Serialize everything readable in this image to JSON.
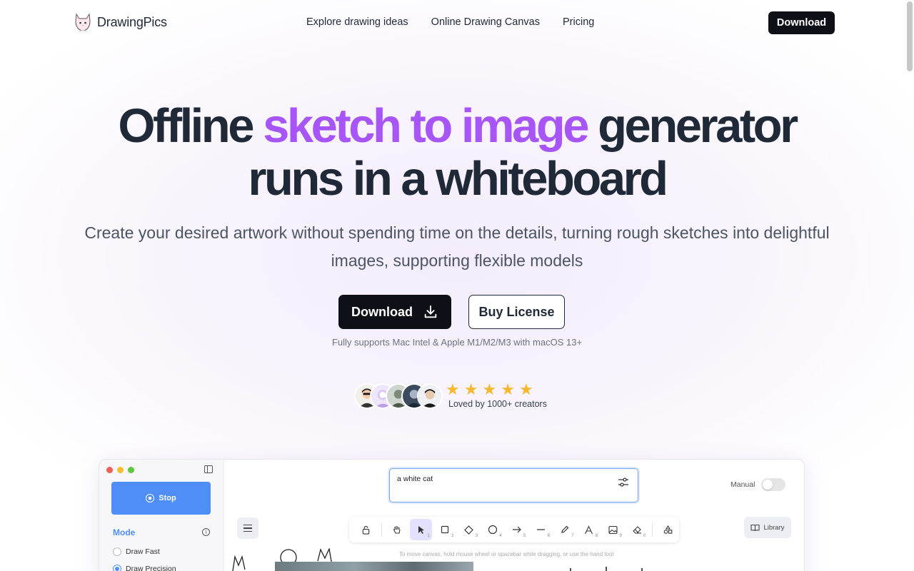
{
  "nav": {
    "brand": "DrawingPics",
    "links": [
      "Explore drawing ideas",
      "Online Drawing Canvas",
      "Pricing"
    ],
    "download_label": "Download"
  },
  "hero": {
    "title_pre": "Offline ",
    "title_highlight": "sketch to image",
    "title_post": " generator",
    "title_line2": "runs in a whiteboard",
    "subtitle": "Create your desired artwork without spending time on the details, turning rough sketches into delightful images, supporting flexible models",
    "download_label": "Download",
    "license_label": "Buy License",
    "support_note": "Fully supports Mac Intel & Apple M1/M2/M3 with macOS 13+",
    "loved_text": "Loved by 1000+ creators",
    "rating_stars": 5,
    "colors": {
      "highlight": "#a855f7",
      "dark_button": "#0d1117",
      "star": "#f5b82e"
    }
  },
  "app": {
    "stop_label": "Stop",
    "mode_label": "Mode",
    "modes": [
      "Draw Fast",
      "Draw Precision"
    ],
    "prompt_value": "a white cat",
    "manual_label": "Manual",
    "library_label": "Library",
    "hint": "To move canvas, hold mouse wheel or spacebar while dragging, or use the hand tool",
    "tool_numbers": [
      "1",
      "2",
      "3",
      "4",
      "5",
      "6",
      "7",
      "8",
      "9",
      "0"
    ],
    "accent": "#4f8ef7"
  }
}
